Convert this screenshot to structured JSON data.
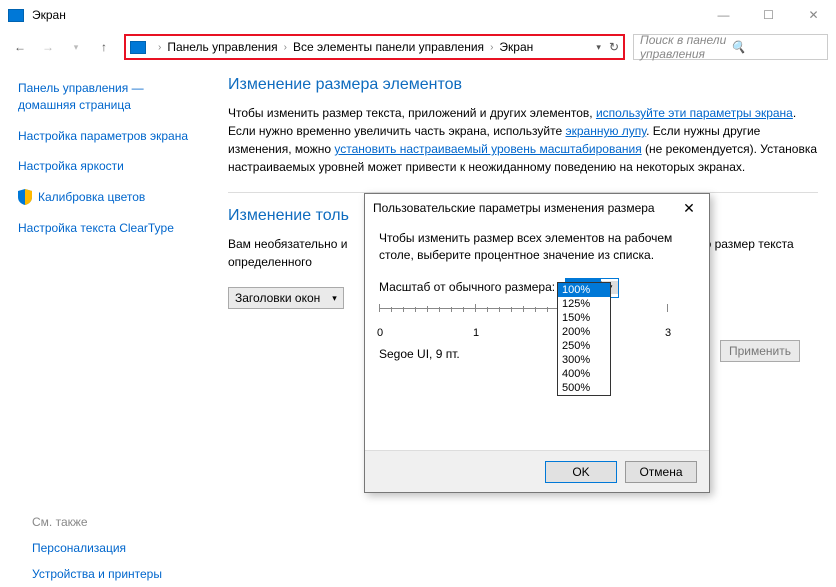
{
  "window": {
    "title": "Экран"
  },
  "nav": {
    "breadcrumb": [
      "Панель управления",
      "Все элементы панели управления",
      "Экран"
    ],
    "search_placeholder": "Поиск в панели управления"
  },
  "sidebar": {
    "home": "Панель управления — домашняя страница",
    "items": [
      "Настройка параметров экрана",
      "Настройка яркости",
      "Калибровка цветов",
      "Настройка текста ClearType"
    ]
  },
  "main": {
    "h1": "Изменение размера элементов",
    "intro_pre": "Чтобы изменить размер текста, приложений и других элементов, ",
    "link1": "используйте эти параметры экрана",
    "intro_post": ". Если нужно временно увеличить часть экрана, используйте ",
    "link2": "экранную лупу",
    "intro_post2": ". Если нужны другие изменения, можно ",
    "link3": "установить настраиваемый уровень масштабирования",
    "intro_post3": " (не рекомендуется). Установка настраиваемых уровней может привести к неожиданному поведению на некоторых экранах.",
    "h2": "Изменение толь",
    "desc_pre": "Вам необязательно и",
    "desc_post": "только размер текста определенного",
    "combo_label": "Заголовки окон",
    "apply": "Применить"
  },
  "dialog": {
    "title": "Пользовательские параметры изменения размера",
    "instruction": "Чтобы изменить размер всех элементов на рабочем столе, выберите процентное значение из списка.",
    "scale_label": "Масштаб от обычного размера:",
    "scale_value": "100%",
    "ruler_labels": [
      "0",
      "1",
      "3"
    ],
    "font_sample": "Segoe UI, 9 пт.",
    "options": [
      "100%",
      "125%",
      "150%",
      "200%",
      "250%",
      "300%",
      "400%",
      "500%"
    ],
    "ok": "OK",
    "cancel": "Отмена"
  },
  "seealso": {
    "header": "См. также",
    "items": [
      "Персонализация",
      "Устройства и принтеры"
    ]
  }
}
